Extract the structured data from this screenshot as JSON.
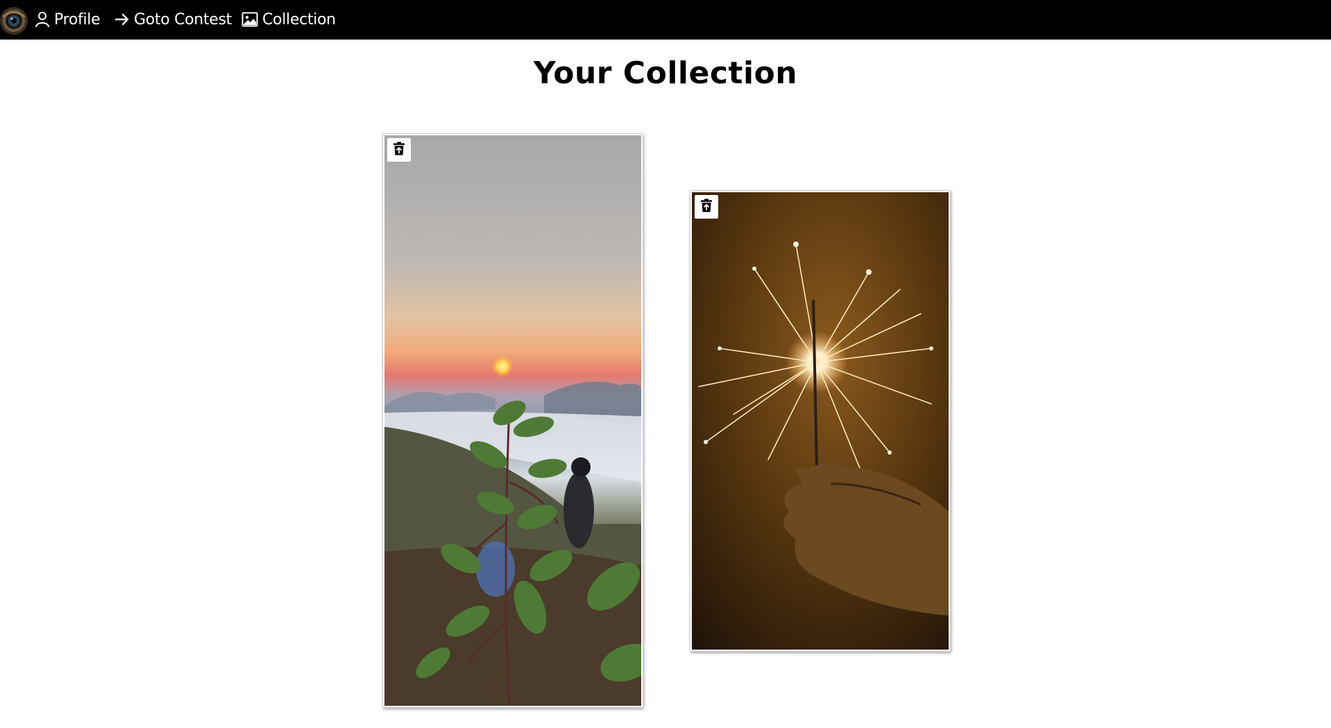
{
  "nav": {
    "logo_icon": "camera-logo-icon",
    "items": [
      {
        "label": "Profile",
        "icon": "user-icon"
      },
      {
        "label": "Goto Contest",
        "icon": "arrow-right-icon"
      },
      {
        "label": "Collection",
        "icon": "image-icon"
      }
    ]
  },
  "page": {
    "title": "Your Collection"
  },
  "collection": [
    {
      "photo": "sunset-plant-photo",
      "remove_icon": "delete-restore-icon"
    },
    {
      "photo": "sparkler-photo",
      "remove_icon": "delete-restore-icon"
    }
  ],
  "colors": {
    "navbar": "#000000",
    "nav_text": "#ffffff",
    "background": "#ffffff",
    "title": "#000000"
  }
}
